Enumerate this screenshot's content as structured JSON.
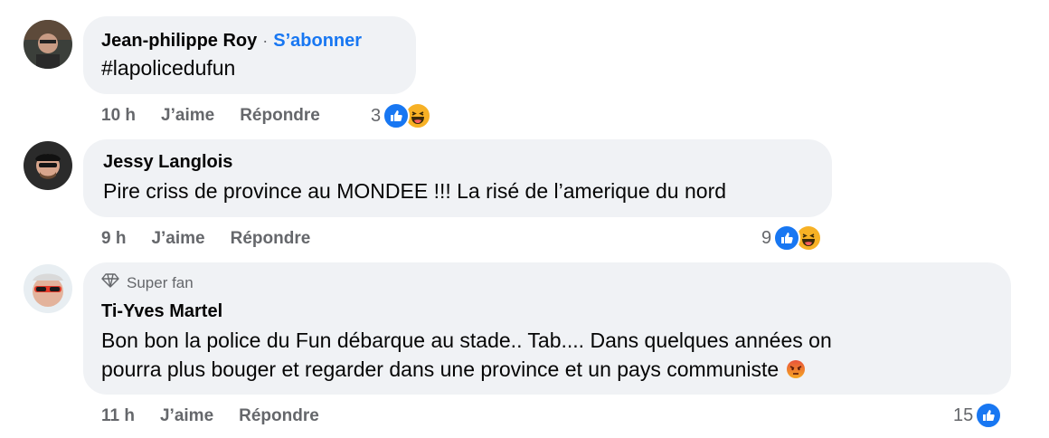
{
  "comments": [
    {
      "author": "Jean-philippe Roy",
      "separator": "·",
      "subscribe": "S’abonner",
      "text": "#lapolicedufun",
      "time": "10 h",
      "like": "J’aime",
      "reply": "Répondre",
      "reaction_count": "3",
      "reactions": [
        "like-icon",
        "haha-icon"
      ]
    },
    {
      "author": "Jessy Langlois",
      "text": "Pire criss de province au MONDEE !!! La risé de l’amerique du nord",
      "time": "9 h",
      "like": "J’aime",
      "reply": "Répondre",
      "reaction_count": "9",
      "reactions": [
        "like-icon",
        "haha-icon"
      ]
    },
    {
      "badge": "Super fan",
      "author": "Ti-Yves Martel",
      "text_line1": "Bon bon la police du Fun débarque au stade.. Tab.... Dans quelques années on",
      "text_line2": "pourra plus bouger et regarder dans une province et un pays communiste",
      "time": "11 h",
      "like": "J’aime",
      "reply": "Répondre",
      "reaction_count": "15",
      "reactions": [
        "like-icon"
      ]
    }
  ],
  "colors": {
    "bubble": "#f0f2f5",
    "meta": "#65676b",
    "link": "#1877f2",
    "like": "#1877f2",
    "haha": "#f7b125",
    "angry": "#e9710f"
  }
}
